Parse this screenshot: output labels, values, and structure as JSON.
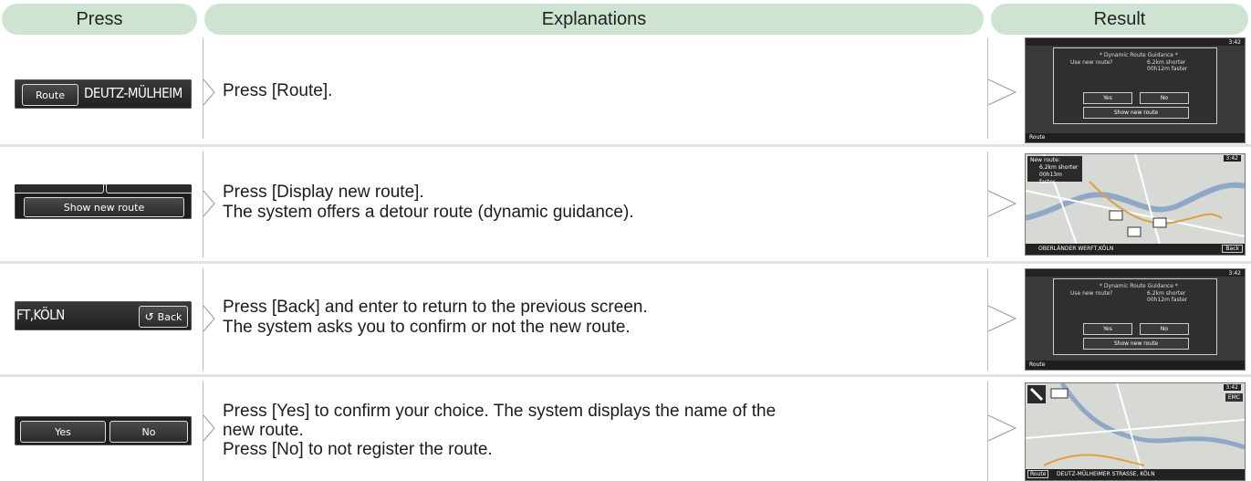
{
  "headers": {
    "press": "Press",
    "explanations": "Explanations",
    "result": "Result"
  },
  "rows": [
    {
      "press": {
        "kind": "route",
        "button": "Route",
        "text": "DEUTZ-MÜLHEIM"
      },
      "lines": [
        "Press [Route]."
      ],
      "result": {
        "kind": "dialog",
        "clock": "3:42",
        "dialog": {
          "title": "* Dynamic Route Guidance *",
          "question": "Use new route?",
          "dist": "6.2km shorter",
          "time": "00h12m faster",
          "yes": "Yes",
          "no": "No",
          "show": "Show new route"
        },
        "bar": "Route"
      }
    },
    {
      "press": {
        "kind": "show",
        "button": "Show new route"
      },
      "lines": [
        "Press [Display new route].",
        "The system offers a detour route (dynamic guidance)."
      ],
      "result": {
        "kind": "map",
        "clock": "3:42",
        "box": [
          "New route:",
          "6.2km shorter",
          "00h13m faster"
        ],
        "street": "OBERLÄNDER WERFT,KÖLN",
        "back": "Back"
      }
    },
    {
      "press": {
        "kind": "back",
        "text": "FT,KÖLN",
        "button": "Back"
      },
      "lines": [
        "Press [Back] and enter to return to the previous screen.",
        "The system asks you to confirm or not the new route."
      ],
      "result": {
        "kind": "dialog",
        "clock": "3:42",
        "dialog": {
          "title": "* Dynamic Route Guidance *",
          "question": "Use new route?",
          "dist": "6.2km shorter",
          "time": "00h12m faster",
          "yes": "Yes",
          "no": "No",
          "show": "Show new route"
        },
        "bar": "Route"
      }
    },
    {
      "press": {
        "kind": "yesno",
        "yes": "Yes",
        "no": "No"
      },
      "lines": [
        "Press [Yes] to confirm your choice. The system displays the name of the",
        "new route.",
        "Press [No] to not register the route."
      ],
      "result": {
        "kind": "map2",
        "clock": "3:42",
        "street": "DEUTZ-MÜLHEIMER STRASSE, KÖLN",
        "route": "Route",
        "tag": "EMC"
      }
    }
  ]
}
